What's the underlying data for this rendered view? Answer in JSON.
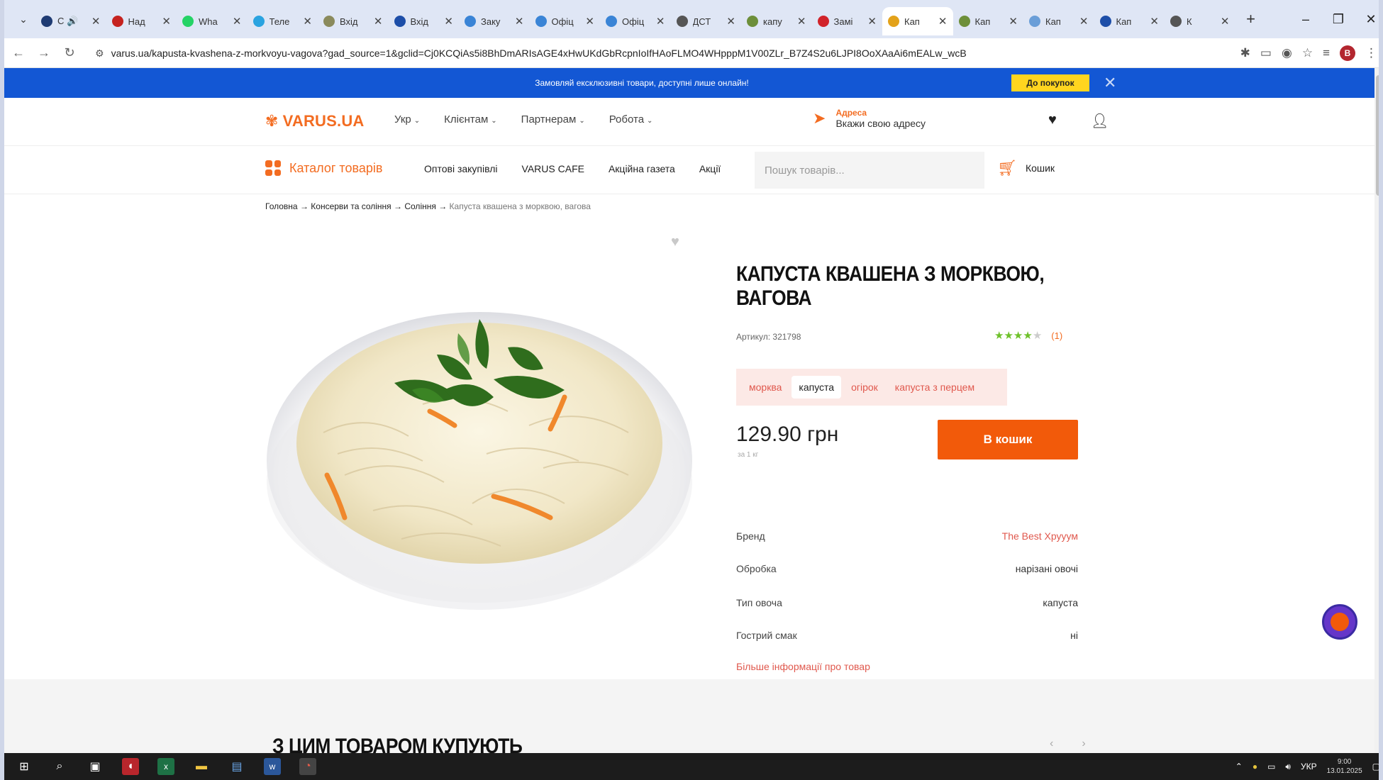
{
  "browser": {
    "tabs": [
      {
        "label": "С 🔊",
        "icon": "circle-dark",
        "color": "#1f3b73",
        "active": false
      },
      {
        "label": "Над",
        "icon": "gmail",
        "color": "#c5221f",
        "active": false
      },
      {
        "label": "Wha",
        "icon": "whatsapp",
        "color": "#25d366",
        "active": false
      },
      {
        "label": "Теле",
        "icon": "telegram",
        "color": "#2aa3e0",
        "active": false
      },
      {
        "label": "Вхід",
        "icon": "sheep",
        "color": "#8a8a5c",
        "active": false
      },
      {
        "label": "Вхід",
        "icon": "document",
        "color": "#1d4ea8",
        "active": false
      },
      {
        "label": "Заку",
        "icon": "half-circle",
        "color": "#3a84d6",
        "active": false
      },
      {
        "label": "Офіц",
        "icon": "half-circle",
        "color": "#3a84d6",
        "active": false
      },
      {
        "label": "Офіц",
        "icon": "half-circle",
        "color": "#3a84d6",
        "active": false
      },
      {
        "label": "ДСТ",
        "icon": "google",
        "color": "#555555",
        "active": false
      },
      {
        "label": "капу",
        "icon": "leaf",
        "color": "#6d8f3a",
        "active": false
      },
      {
        "label": "Замі",
        "icon": "red-square",
        "color": "#d1232a",
        "active": false
      },
      {
        "label": "Кап",
        "icon": "window",
        "color": "#e3a21a",
        "active": true
      },
      {
        "label": "Кап",
        "icon": "leaf",
        "color": "#6d8f3a",
        "active": false
      },
      {
        "label": "Кап",
        "icon": "feather",
        "color": "#6a9ed8",
        "active": false
      },
      {
        "label": "Кап",
        "icon": "square-outline",
        "color": "#1d4ea8",
        "active": false
      },
      {
        "label": "К",
        "icon": "wifi",
        "color": "#555555",
        "active": false
      }
    ],
    "close_glyph": "✕",
    "new_tab_glyph": "+",
    "window_controls": {
      "minimize": "–",
      "restore": "❐",
      "close": "✕"
    },
    "url": "varus.ua/kapusta-kvashena-z-morkvoyu-vagova?gad_source=1&gclid=Cj0KCQiAs5i8BhDmARIsAGE4xHwUKdGbRcpnIoIfHAoFLMO4WHpppM1V00ZLr_B7Z4S2u6LJPI8OoXAaAi6mEALw_wcB",
    "profile_initial": "B"
  },
  "site": {
    "promo_text": "Замовляй ексклюзивні товари, доступні лише онлайн!",
    "promo_button": "До покупок",
    "logo_text": "VARUS.UA",
    "menu": [
      "Укр",
      "Клієнтам",
      "Партнерам",
      "Робота"
    ],
    "address_caption": "Адреса",
    "address_value": "Вкажи свою адресу",
    "catalog_label": "Каталог товарів",
    "cat_links": [
      "Оптові закупівлі",
      "VARUS CAFE",
      "Акційна газета",
      "Акції"
    ],
    "search_placeholder": "Пошук товарів...",
    "cart_label": "Кошик",
    "accent": "#f36c21",
    "promo_bg": "#1357d4"
  },
  "breadcrumb": {
    "items": [
      "Головна",
      "Консерви та соління",
      "Соління"
    ],
    "current": "Капуста квашена з морквою, вагова",
    "separator": "→"
  },
  "product": {
    "title": "КАПУСТА КВАШЕНА З МОРКВОЮ, ВАГОВА",
    "sku": "Артикул: 321798",
    "rating": 4,
    "rating_max": 5,
    "reviews": "(1)",
    "variants": [
      "морква",
      "капуста",
      "огірок",
      "капуста з перцем"
    ],
    "selected_variant": 1,
    "price": "129.90 грн",
    "price_unit": "за 1 кг",
    "buy_label": "В кошик",
    "specs": [
      {
        "name": "Бренд",
        "value": "The Best Хрууум",
        "link": true
      },
      {
        "name": "Обробка",
        "value": "нарізані овочі",
        "link": false
      },
      {
        "name": "Тип овоча",
        "value": "капуста",
        "link": false
      },
      {
        "name": "Гострий смак",
        "value": "ні",
        "link": false
      }
    ],
    "more_info": "Більше інформації про товар",
    "also_bought": "З ЦИМ ТОВАРОМ КУПУЮТЬ"
  },
  "taskbar": {
    "apps": [
      "start",
      "search",
      "task-view",
      "app-red",
      "excel",
      "explorer",
      "save",
      "word",
      "chrome"
    ],
    "lang": "УКР",
    "clock_time": "9:00",
    "clock_date": "13.01.2025"
  }
}
